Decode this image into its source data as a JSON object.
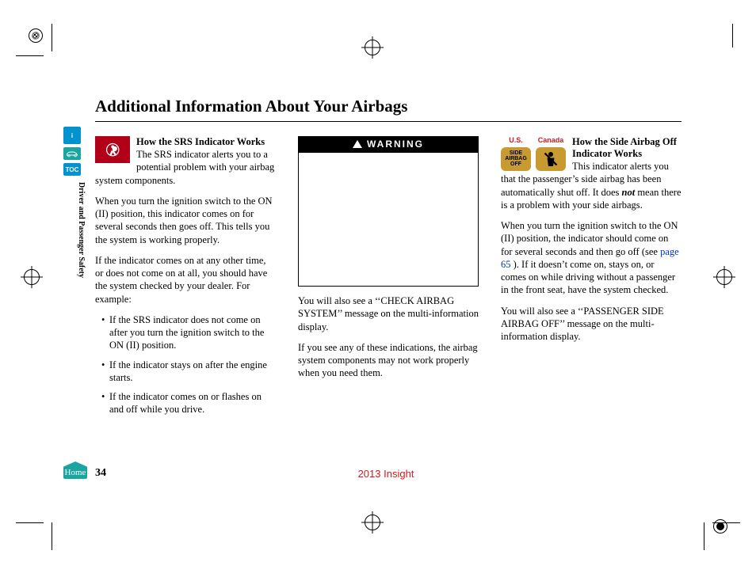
{
  "title": "Additional Information About Your Airbags",
  "section_label": "Driver and Passenger Safety",
  "sidebar": {
    "info": "i",
    "toc": "TOC",
    "home": "Home"
  },
  "footer": {
    "page": "34",
    "model": "2013 Insight"
  },
  "col1": {
    "subhead": "How the SRS Indicator Works",
    "p1": "The SRS indicator alerts you to a potential problem with your airbag system components.",
    "p2": "When you turn the ignition switch to the ON (II) position, this indicator comes on for several seconds then goes off. This tells you the system is working properly.",
    "p3": "If the indicator comes on at any other time, or does not come on at all, you should have the system checked by your dealer. For example:",
    "b1": "If the SRS indicator does not come on after you turn the ignition switch to the ON (II) position.",
    "b2": "If the indicator stays on after the engine starts.",
    "b3": "If the indicator comes on or flashes on and off while you drive."
  },
  "col2": {
    "warning": "WARNING",
    "p1": "You will also see a ‘‘CHECK AIRBAG SYSTEM’’ message on the multi-information display.",
    "p2": "If you see any of these indications, the airbag system components may not work properly when you need them."
  },
  "col3": {
    "us_label": "U.S.",
    "ca_label": "Canada",
    "us_badge_text": "SIDE\nAIRBAG\nOFF",
    "subhead": "How the Side Airbag Off Indicator Works",
    "p1a": "This indicator alerts you that the passenger’s side airbag has been automatically shut off. It does ",
    "p1_not": "not",
    "p1b": " mean there is a problem with your side airbags.",
    "p2a": "When you turn the ignition switch to the ON (II) position, the indicator should come on for several seconds and then go off (see ",
    "p2_link": "page 65",
    "p2b": " ). If it doesn’t come on, stays on, or comes on while driving without a passenger in the front seat, have the system checked.",
    "p3": "You will also see a ‘‘PASSENGER SIDE AIRBAG OFF’’ message on the multi-information display."
  }
}
